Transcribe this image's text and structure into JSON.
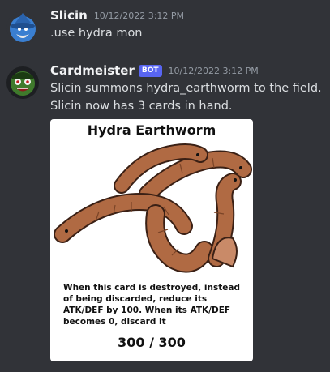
{
  "messages": [
    {
      "username": "Slicin",
      "timestamp": "10/12/2022 3:12 PM",
      "lines": [
        ".use hydra mon"
      ],
      "avatar_icon": "wizard-avatar"
    },
    {
      "username": "Cardmeister",
      "bot_tag": "BOT",
      "timestamp": "10/12/2022 3:12 PM",
      "lines": [
        "Slicin summons hydra_earthworm to the field.",
        "Slicin now has 3 cards in hand."
      ],
      "avatar_icon": "goblin-avatar"
    }
  ],
  "card": {
    "title": "Hydra Earthworm",
    "description": "When this card is destroyed, instead of being discarded, reduce its ATK/DEF by 100.  When its ATK/DEF becomes 0, discard it",
    "stats": "300 / 300",
    "art_icon": "earthworm-hydra-art"
  },
  "colors": {
    "background": "#313338",
    "username": "#f2f3f5",
    "message_text": "#dbdee1",
    "timestamp": "#949ba4",
    "bot_tag": "#5865f2",
    "worm": "#b06a43"
  }
}
